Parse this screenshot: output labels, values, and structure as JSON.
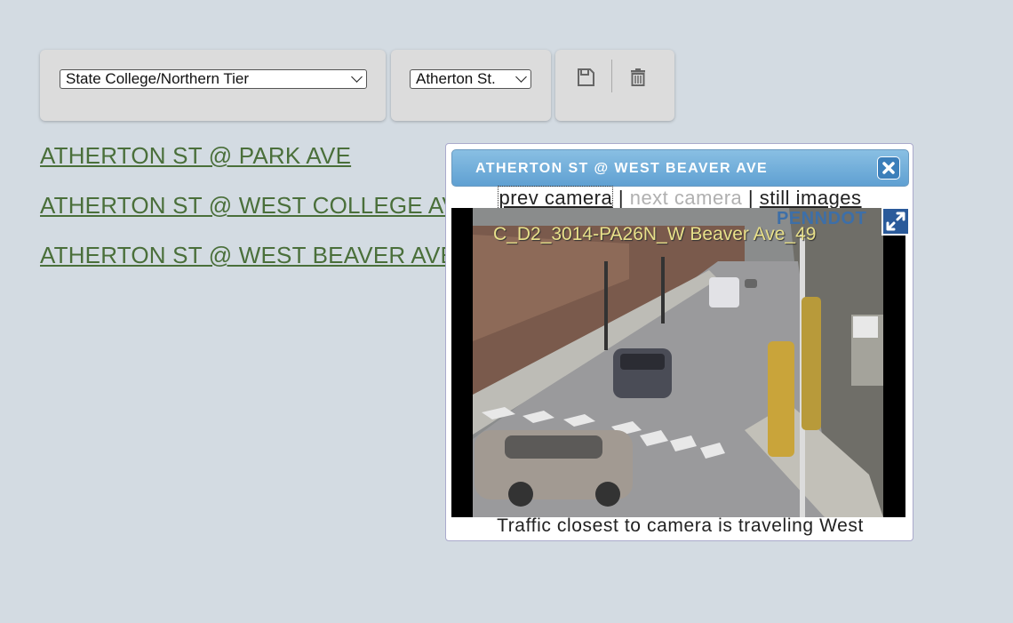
{
  "toolbar": {
    "region_selected": "State College/Northern Tier",
    "road_selected": "Atherton St.",
    "save_icon": "save-icon",
    "delete_icon": "trash-icon"
  },
  "camera_links": [
    "ATHERTON ST @ PARK AVE",
    "ATHERTON ST @ WEST COLLEGE AVE",
    "ATHERTON ST @ WEST BEAVER AVE"
  ],
  "popup": {
    "title": "ATHERTON ST @ WEST BEAVER AVE",
    "close_icon": "close-icon",
    "prev_label": "prev camera",
    "separator": "|",
    "next_label": "next camera",
    "still_label": "still images",
    "camera_overlay": "C_D2_3014-PA26N_W Beaver Ave_49",
    "camera_logo": "PENNDOT",
    "expand_icon": "expand-icon",
    "caption": "Traffic closest to camera is traveling West"
  },
  "colors": {
    "background": "#d3dbe2",
    "link": "#4a6f3a",
    "header_blue": "#5fa0d2"
  }
}
